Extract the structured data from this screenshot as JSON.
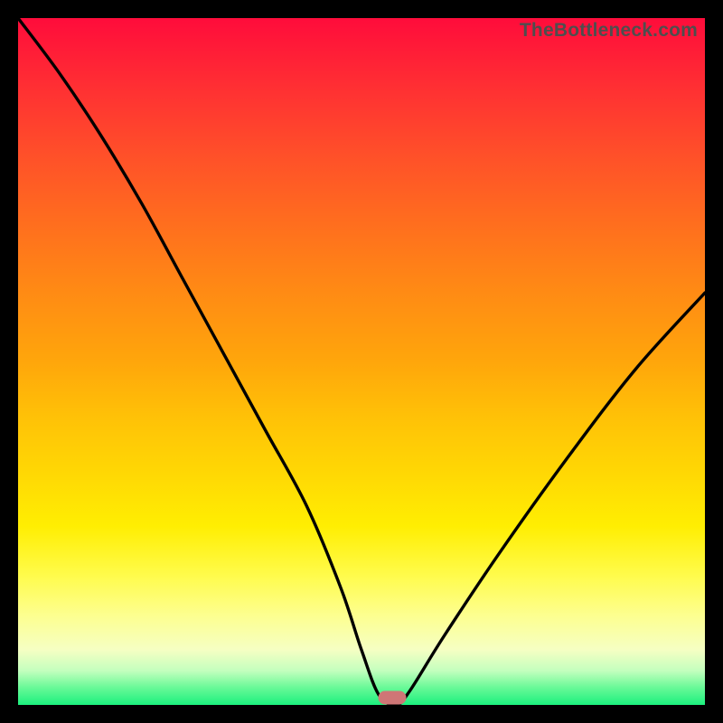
{
  "source_label": "TheBottleneck.com",
  "chart_data": {
    "type": "line",
    "title": "",
    "xlabel": "",
    "ylabel": "",
    "xlim": [
      0,
      100
    ],
    "ylim": [
      0,
      100
    ],
    "series": [
      {
        "name": "bottleneck-curve",
        "x": [
          0,
          6,
          12,
          18,
          24,
          30,
          36,
          42,
          47,
          50,
          52.5,
          55,
          57,
          62,
          70,
          80,
          90,
          100
        ],
        "values": [
          100,
          92,
          83,
          73,
          62,
          51,
          40,
          29,
          17,
          8,
          1.5,
          0,
          2,
          10,
          22,
          36,
          49,
          60
        ]
      }
    ],
    "marker": {
      "x": 54.5,
      "y": 1
    },
    "gradient_stops": [
      {
        "pct": 0,
        "color": "#ff0c3b"
      },
      {
        "pct": 50,
        "color": "#ffa60b"
      },
      {
        "pct": 80,
        "color": "#fffb4a"
      },
      {
        "pct": 100,
        "color": "#1cf07e"
      }
    ]
  }
}
